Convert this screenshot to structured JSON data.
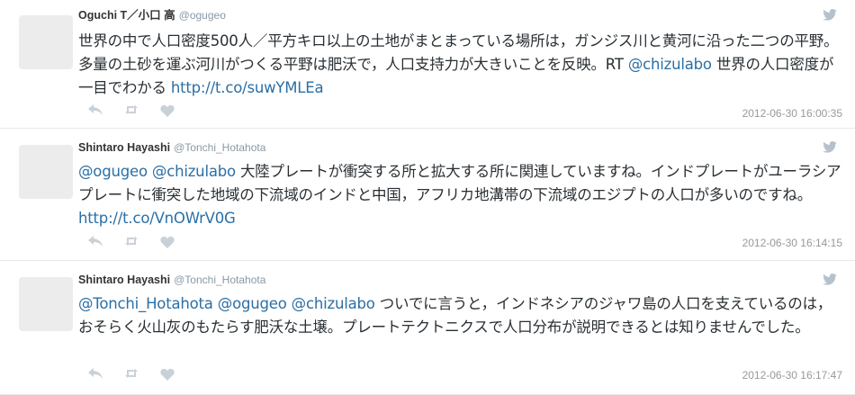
{
  "tweets": [
    {
      "fullname": "Oguchi T／小口 高",
      "username": "@ogugeo",
      "text_before": "世界の中で人口密度500人／平方キロ以上の土地がまとまっている場所は，ガンジス川と黄河に沿った二つの平野。多量の土砂を運ぶ河川がつくる平野は肥沃で，人口支持力が大きいことを反映。RT ",
      "mention": "@chizulabo",
      "text_after": " 世界の人口密度が一目でわかる ",
      "url": "http://t.co/suwYMLEa",
      "timestamp": "2012-06-30 16:00:35"
    },
    {
      "fullname": "Shintaro Hayashi",
      "username": "@Tonchi_Hotahota",
      "mention1": "@ogugeo",
      "mention2": "@chizulabo",
      "text": "  大陸プレートが衝突する所と拡大する所に関連していますね。インドプレートがユーラシアプレートに衝突した地域の下流域のインドと中国，アフリカ地溝帯の下流域のエジプトの人口が多いのですね。",
      "url": "http://t.co/VnOWrV0G",
      "timestamp": "2012-06-30 16:14:15"
    },
    {
      "fullname": "Shintaro Hayashi",
      "username": "@Tonchi_Hotahota",
      "mention1": "@Tonchi_Hotahota",
      "mention2": "@ogugeo",
      "mention3": "@chizulabo",
      "text": " ついでに言うと，インドネシアのジャワ島の人口を支えているのは，おそらく火山灰のもたらす肥沃な土壌。プレートテクトニクスで人口分布が説明できるとは知りませんでした。",
      "timestamp": "2012-06-30 16:17:47"
    }
  ],
  "icons": {
    "bird": "twitter-bird-icon",
    "reply": "reply-icon",
    "retweet": "retweet-icon",
    "favorite": "favorite-icon"
  },
  "colors": {
    "link": "#2b6fa5",
    "muted": "#999999",
    "icon": "#c9d1d8"
  }
}
